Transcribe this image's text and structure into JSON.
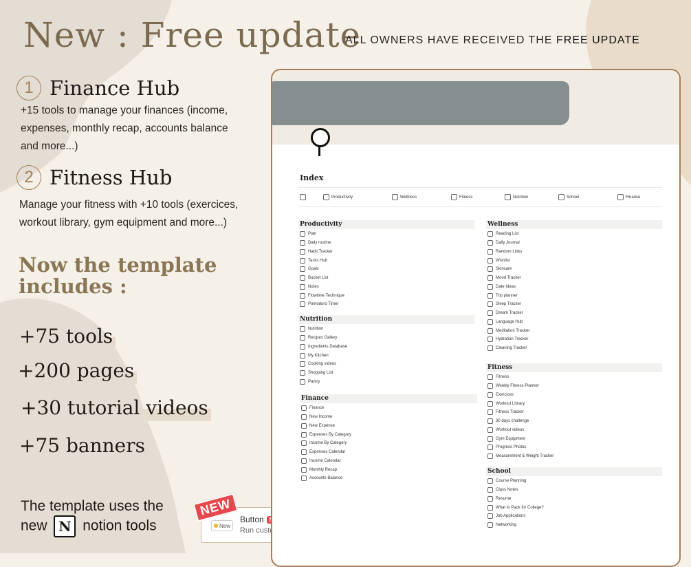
{
  "headline": "New : Free update",
  "subline": {
    "prefix": "ALL OWNERS HAVE RECEIVED THE",
    "bold": "FREE UPDATE"
  },
  "hubs": [
    {
      "num": "1",
      "name": "Finance Hub",
      "desc_lines": [
        "+15 tools to manage your finances (income,",
        "expenses, monthly recap, accounts balance",
        "and more...)"
      ]
    },
    {
      "num": "2",
      "name": "Fitness Hub",
      "desc_lines": [
        "Manage your fitness with +10 tools (exercices,",
        "workout library, gym equipment and more...)"
      ]
    }
  ],
  "includes": {
    "line1": "Now the template",
    "line2": "includes :"
  },
  "stats": [
    "+75 tools",
    "+200 pages",
    "+30 tutorial videos",
    "+75 banners"
  ],
  "uses": {
    "line1": "The template uses the",
    "pre": "new",
    "logo": "N",
    "post": "notion tools"
  },
  "callout": {
    "flag": "NEW",
    "button_inner": "New",
    "title": "Button",
    "badge": "NEW",
    "desc": "Run custom automations with a click."
  },
  "notion": {
    "index_title": "Index",
    "index_items": [
      "",
      "Productivity",
      "Wellness",
      "Fitness",
      "Nutrition",
      "School",
      "Finance"
    ],
    "sections": {
      "productivity": {
        "title": "Productivity",
        "items": [
          "Plan",
          "Daily routine",
          "Habit Tracker",
          "Tasks Hub",
          "Goals",
          "Bucket List",
          "Notes",
          "Flowtime Technique",
          "Pomodoro Timer"
        ]
      },
      "nutrition": {
        "title": "Nutrition",
        "items": [
          "Nutrition",
          "Recipes Gallery",
          "Ingredients Database",
          "My Kitchen",
          "Cooking videos",
          "Shopping List",
          "Pantry"
        ]
      },
      "finance": {
        "title": "Finance",
        "items": [
          "Finance",
          "New Income",
          "New Expense",
          "Expenses By Category",
          "Income By Category",
          "Expenses Calendar",
          "Income Calendar",
          "Monthly Recap",
          "Accounts Balance"
        ]
      },
      "wellness": {
        "title": "Wellness",
        "items": [
          "Reading List",
          "Daily Journal",
          "Random Links",
          "Wishlist",
          "Skincare",
          "Mood Tracker",
          "Date Ideas",
          "Trip planner",
          "Sleep Tracker",
          "Dream Tracker",
          "Language Hub",
          "Meditation Tracker",
          "Hydration Tracker",
          "Cleaning Tracker"
        ]
      },
      "fitness": {
        "title": "Fitness",
        "items": [
          "Fitness",
          "Weekly Fitness Planner",
          "Exercices",
          "Workout Library",
          "Fitness Tracker",
          "30 days challenge",
          "Workout videos",
          "Gym Equipment",
          "Progress Photos",
          "Measurement & Weight Tracker"
        ]
      },
      "school": {
        "title": "School",
        "items": [
          "Course Planning",
          "Class Notes",
          "Resume",
          "What to Pack for College?",
          "Job Applications",
          "Networking"
        ]
      }
    }
  }
}
